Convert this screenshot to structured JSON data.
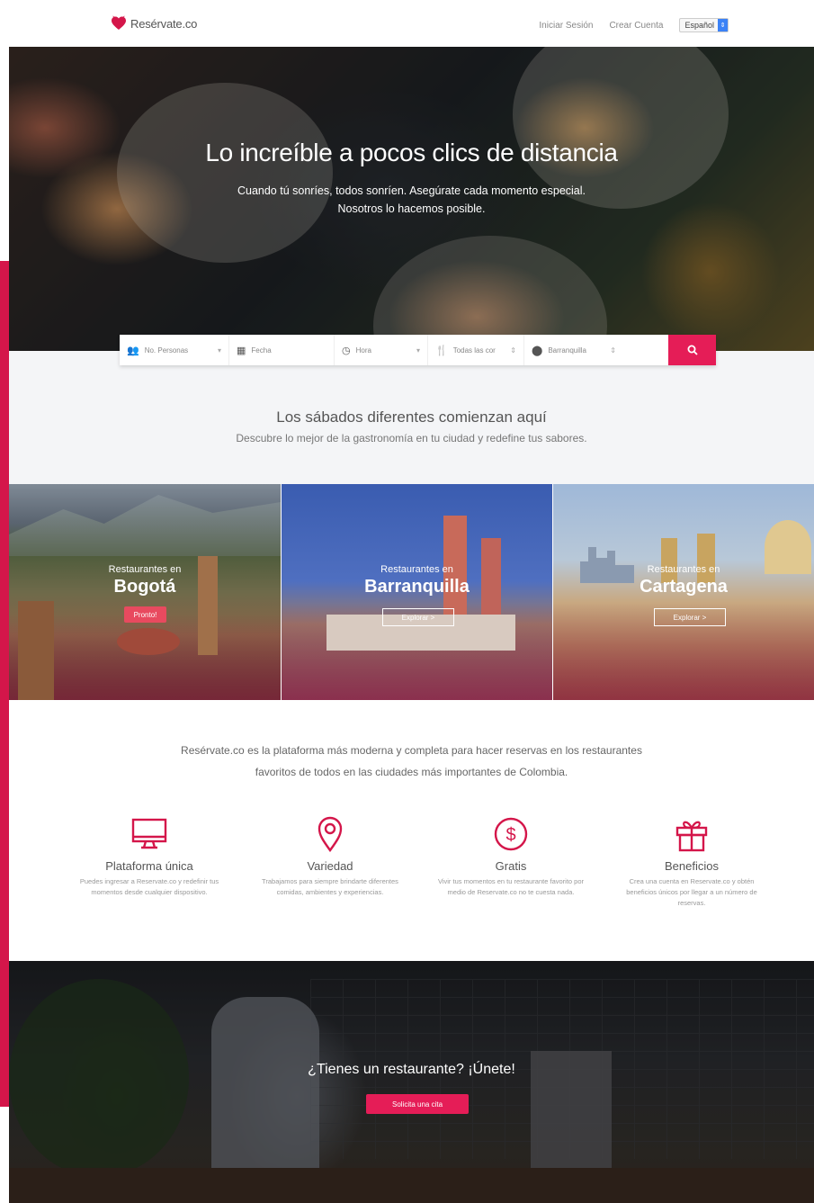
{
  "header": {
    "brand": "Resérvate.co",
    "login": "Iniciar Sesión",
    "signup": "Crear Cuenta",
    "language": "Español"
  },
  "hero": {
    "title": "Lo increíble a pocos clics de distancia",
    "subtitle_line1": "Cuando tú sonríes, todos sonríen. Asegúrate cada momento especial.",
    "subtitle_line2": "Nosotros lo hacemos posible."
  },
  "search": {
    "people": "No. Personas",
    "date": "Fecha",
    "time": "Hora",
    "category": "Todas las cor",
    "city": "Barranquilla"
  },
  "intro": {
    "title": "Los sábados diferentes comienzan aquí",
    "subtitle": "Descubre lo mejor de la gastronomía en tu ciudad y redefine tus sabores."
  },
  "cities": [
    {
      "prefix": "Restaurantes en",
      "name": "Bogotá",
      "action": "Pronto!"
    },
    {
      "prefix": "Restaurantes en",
      "name": "Barranquilla",
      "action": "Explorar >"
    },
    {
      "prefix": "Restaurantes en",
      "name": "Cartagena",
      "action": "Explorar >"
    }
  ],
  "about": {
    "line1": "Resérvate.co es la plataforma más moderna y completa para hacer reservas en los restaurantes",
    "line2": "favoritos de todos en las ciudades más importantes de Colombia."
  },
  "features": [
    {
      "title": "Plataforma única",
      "icon": "monitor-icon",
      "desc": "Puedes ingresar a Reservate.co y redefinir tus momentos desde cualquier dispositivo."
    },
    {
      "title": "Variedad",
      "icon": "location-pin-icon",
      "desc": "Trabajamos para siempre brindarte diferentes comidas, ambientes y experiencias."
    },
    {
      "title": "Gratis",
      "icon": "dollar-coin-icon",
      "desc": "Vivir tus momentos en tu restaurante favorito por medio de Reservate.co no te cuesta nada."
    },
    {
      "title": "Beneficios",
      "icon": "gift-icon",
      "desc": "Crea una cuenta en Reservate.co y obtén beneficios únicos por llegar a un número de reservas."
    }
  ],
  "cta": {
    "title": "¿Tienes un restaurante? ¡Únete!",
    "button": "Solicita una cita"
  },
  "colors": {
    "accent": "#e51d57",
    "band": "#d4164a"
  }
}
